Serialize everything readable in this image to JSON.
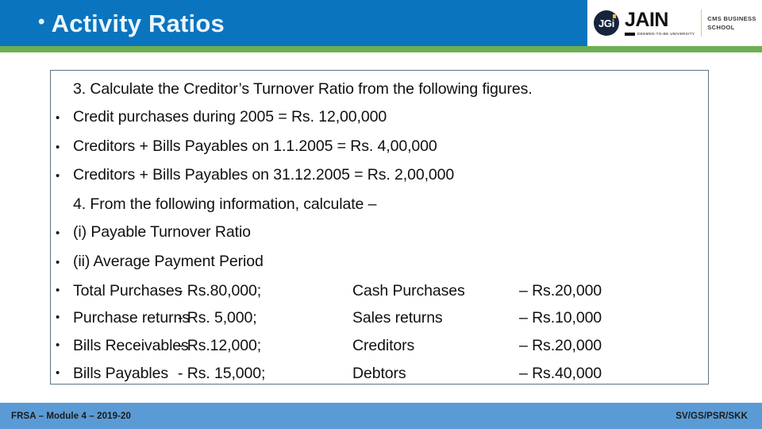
{
  "header": {
    "bullet": "•",
    "title": "Activity Ratios",
    "bar_color": "#0B74BE",
    "stripe_color": "#6DAF53"
  },
  "logo": {
    "badge_text": "JGi",
    "brand": "JAIN",
    "brand_sub": "DEEMED-TO-BE UNIVERSITY",
    "school_line1": "CMS BUSINESS",
    "school_line2": "SCHOOL"
  },
  "content": {
    "lines": [
      {
        "bullet": "",
        "text": "3. Calculate the Creditor’s Turnover Ratio from the following figures."
      },
      {
        "bullet": "•",
        "text": "Credit purchases during 2005 = Rs. 12,00,000"
      },
      {
        "bullet": "•",
        "text": "Creditors + Bills Payables on 1.1.2005 = Rs. 4,00,000"
      },
      {
        "bullet": "•",
        "text": "Creditors + Bills Payables on 31.12.2005 = Rs. 2,00,000"
      },
      {
        "bullet": "",
        "text": "4. From the following information, calculate –"
      },
      {
        "bullet": "•",
        "text": "(i) Payable Turnover Ratio"
      },
      {
        "bullet": "•",
        "text": "(ii) Average Payment Period"
      }
    ],
    "table_rows": [
      {
        "bullet": "•",
        "label": "Total Purchases",
        "amount1": "- Rs.80,000;",
        "label2": "Cash Purchases",
        "amount2": "– Rs.20,000"
      },
      {
        "bullet": "•",
        "label": "Purchase returns",
        "amount1": "- Rs. 5,000;",
        "label2": "Sales returns",
        "amount2": "– Rs.10,000"
      },
      {
        "bullet": "•",
        "label": "Bills Receivables",
        "amount1": "- Rs.12,000;",
        "label2": "Creditors",
        "amount2": "– Rs.20,000"
      },
      {
        "bullet": "•",
        "label": "Bills Payables",
        "amount1": "- Rs. 15,000;",
        "label2": "Debtors",
        "amount2": "– Rs.40,000"
      }
    ]
  },
  "footer": {
    "left": "FRSA – Module 4 – 2019-20",
    "right": "SV/GS/PSR/SKK",
    "bar_color": "#5B9BD5"
  }
}
